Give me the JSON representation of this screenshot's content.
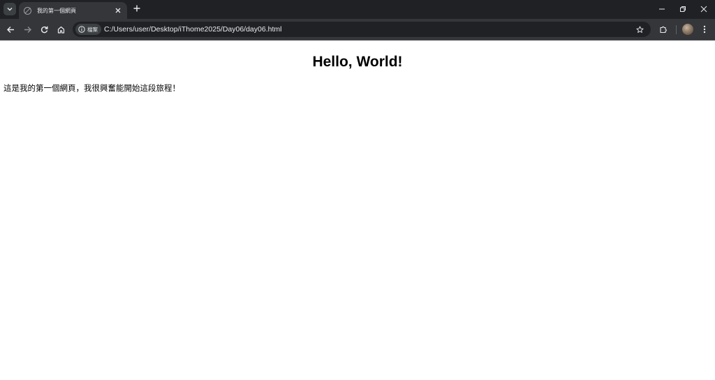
{
  "browser": {
    "tab": {
      "title": "我的第一個網頁",
      "close_icon": "close-icon",
      "favicon_icon": "blocked-favicon-icon"
    },
    "tab_search_icon": "chevron-down-icon",
    "new_tab_icon": "plus-icon",
    "window_controls": {
      "minimize_icon": "minimize-icon",
      "restore_icon": "restore-icon",
      "close_icon": "close-icon"
    },
    "toolbar": {
      "back_icon": "arrow-left-icon",
      "forward_icon": "arrow-right-icon",
      "reload_icon": "reload-icon",
      "home_icon": "home-icon",
      "info_chip_label": "檔案",
      "url": "C:/Users/user/Desktop/iThome2025/Day06/day06.html",
      "bookmark_icon": "star-icon",
      "extensions_icon": "puzzle-icon",
      "menu_icon": "more-vertical-icon"
    },
    "colors": {
      "tabbar_bg": "#202124",
      "toolbar_bg": "#35363a",
      "text": "#e8eaed"
    }
  },
  "page": {
    "heading": "Hello, World!",
    "paragraph": "這是我的第一個網頁，我很興奮能開始這段旅程！"
  }
}
